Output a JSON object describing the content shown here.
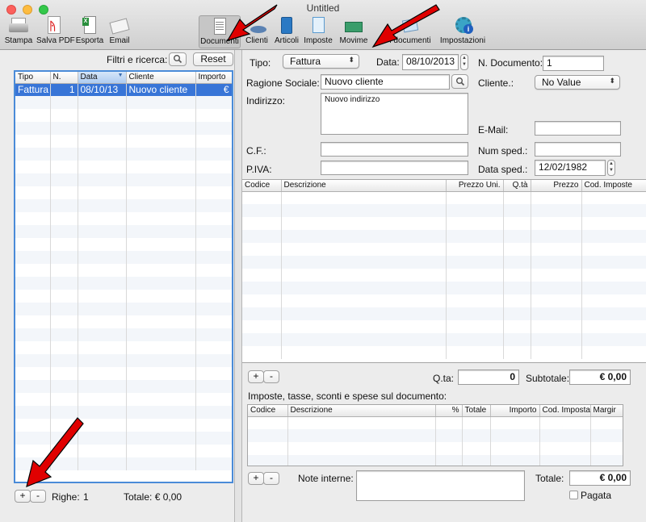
{
  "window": {
    "title": "Untitled"
  },
  "toolbar": [
    {
      "label": "Stampa",
      "icon": "printer-icon"
    },
    {
      "label": "Salva PDF",
      "icon": "pdf-icon"
    },
    {
      "label": "Esporta",
      "icon": "spreadsheet-icon"
    },
    {
      "label": "Email",
      "icon": "envelope-icon"
    },
    {
      "label": "Documenti",
      "icon": "document-icon",
      "selected": true
    },
    {
      "label": "Clienti",
      "icon": "clients-icon"
    },
    {
      "label": "Articoli",
      "icon": "book-icon"
    },
    {
      "label": "Imposte",
      "icon": "tax-icon"
    },
    {
      "label": "Movime",
      "icon": "money-icon"
    },
    {
      "label": "i documenti",
      "icon": "documents-icon"
    },
    {
      "label": "Impostazioni",
      "icon": "gear-icon"
    }
  ],
  "sidebar": {
    "filter_label": "Filtri e ricerca:",
    "reset_label": "Reset",
    "columns": [
      "Tipo",
      "N.",
      "Data",
      "Cliente",
      "Importo"
    ],
    "rows": [
      {
        "tipo": "Fattura",
        "n": "1",
        "data": "08/10/13",
        "cliente": "Nuovo cliente",
        "importo": "€"
      }
    ],
    "add_label": "+",
    "remove_label": "-",
    "righe_label": "Righe:",
    "righe_value": "1",
    "totale_label": "Totale: € 0,00"
  },
  "form": {
    "tipo_label": "Tipo:",
    "tipo_value": "Fattura",
    "data_label": "Data:",
    "data_value": "08/10/2013",
    "ndoc_label": "N. Documento:",
    "ndoc_value": "1",
    "ragione_label": "Ragione Sociale:",
    "ragione_value": "Nuovo cliente",
    "cliente_label": "Cliente.:",
    "cliente_value": "No Value",
    "indirizzo_label": "Indirizzo:",
    "indirizzo_value": "Nuovo indirizzo",
    "email_label": "E-Mail:",
    "email_value": "",
    "cf_label": "C.F.:",
    "cf_value": "",
    "numsped_label": "Num sped.:",
    "numsped_value": "",
    "piva_label": "P.IVA:",
    "piva_value": "",
    "datasped_label": "Data sped.:",
    "datasped_value": "12/02/1982"
  },
  "items": {
    "columns": [
      "Codice",
      "Descrizione",
      "Prezzo Uni.",
      "Q.tà",
      "Prezzo",
      "Cod. Imposte"
    ],
    "add_label": "+",
    "remove_label": "-",
    "qta_label": "Q.ta:",
    "qta_value": "0",
    "subtotale_label": "Subtotale:",
    "subtotale_value": "€ 0,00"
  },
  "taxes": {
    "heading": "Imposte, tasse, sconti e spese sul documento:",
    "columns": [
      "Codice",
      "Descrizione",
      "%",
      "Totale",
      "Importo",
      "Cod. Imposta",
      "Margir"
    ],
    "add_label": "+",
    "remove_label": "-"
  },
  "footer": {
    "note_label": "Note interne:",
    "note_value": "",
    "totale_label": "Totale:",
    "totale_value": "€ 0,00",
    "pagata_label": "Pagata"
  },
  "colors": {
    "selection": "#3875d7",
    "annotation_arrow": "#ff0000"
  }
}
